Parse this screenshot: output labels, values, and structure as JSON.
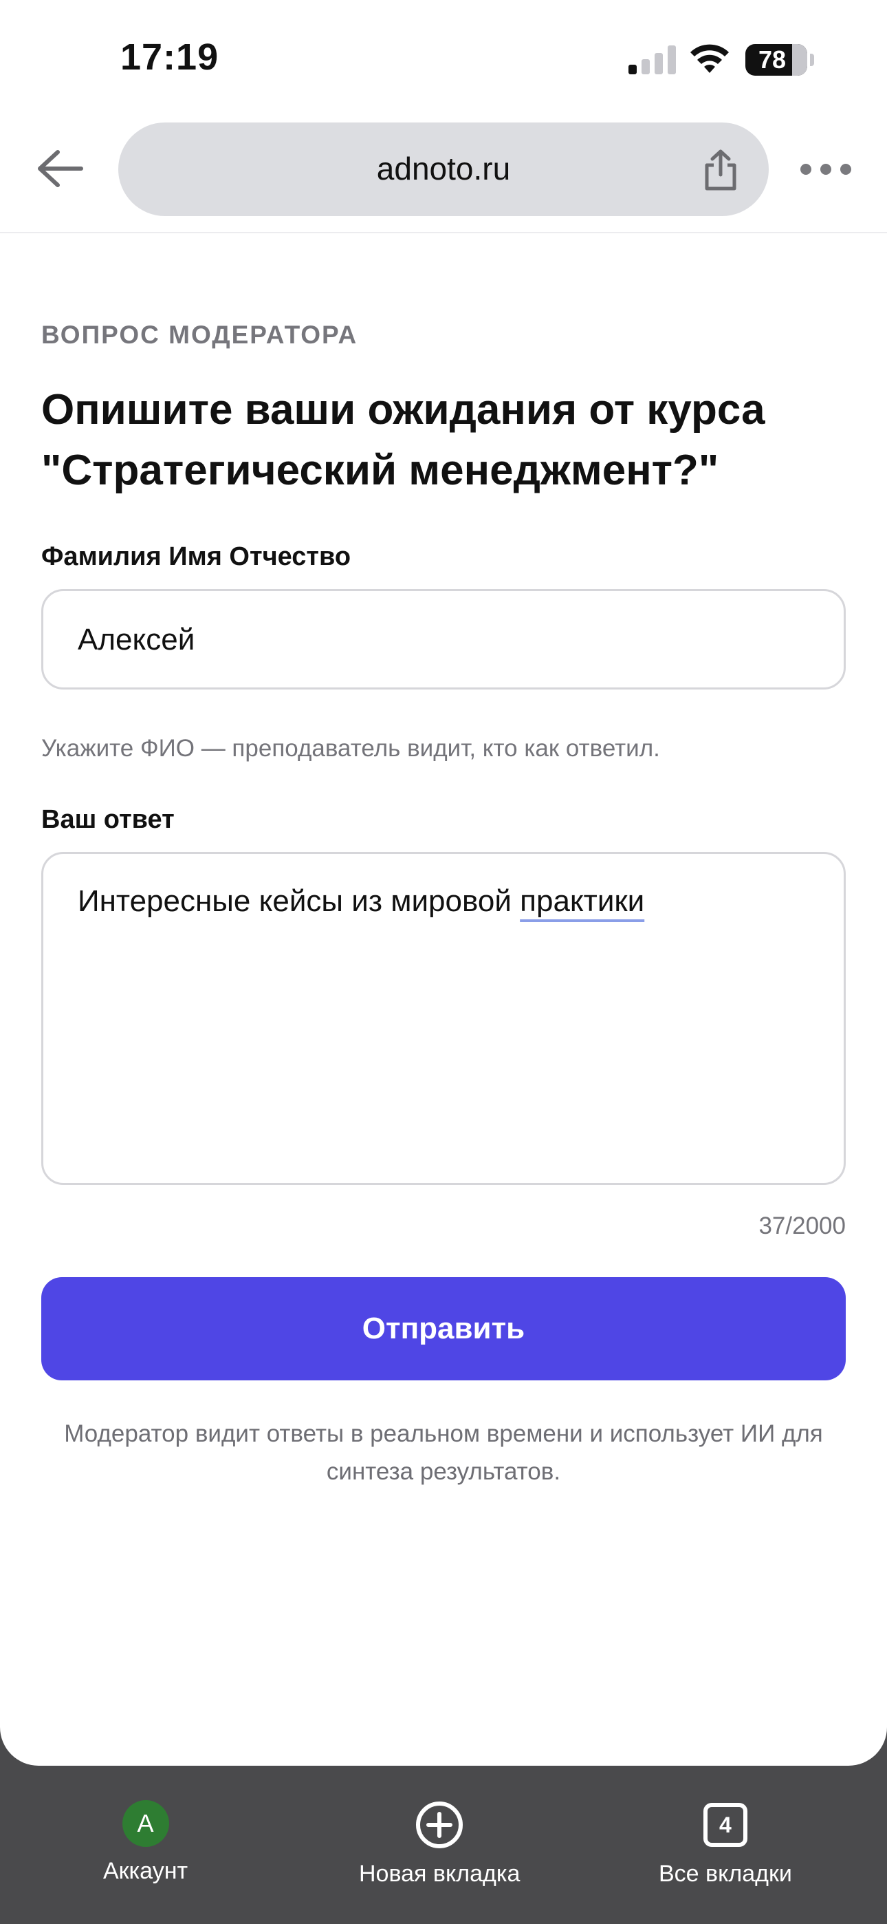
{
  "status_bar": {
    "time": "17:19",
    "battery": "78"
  },
  "browser": {
    "url": "adnoto.ru"
  },
  "form": {
    "overline": "ВОПРОС МОДЕРАТОРА",
    "question": "Опишите ваши ожидания от курса \"Стратегический менеджмент?\"",
    "name_label": "Фамилия Имя Отчество",
    "name_value": "Алексей",
    "name_hint": "Укажите ФИО — преподаватель видит, кто как ответил.",
    "answer_label": "Ваш ответ",
    "answer_value_part1": "Интересные кейсы из мировой ",
    "answer_value_part2": "практики",
    "counter": "37/2000",
    "submit_label": "Отправить",
    "footer_note": "Модератор видит ответы в реальном времени и использует ИИ для синтеза результатов."
  },
  "toolbar": {
    "account_initial": "А",
    "account_label": "Аккаунт",
    "new_tab_label": "Новая вкладка",
    "tabs_count": "4",
    "all_tabs_label": "Все вкладки"
  },
  "colors": {
    "accent": "#4f46e5",
    "avatar": "#2e7d32"
  },
  "icons": [
    "back-arrow-icon",
    "share-icon",
    "more-icon",
    "plus-circle-icon",
    "tabs-icon",
    "signal-icon",
    "wifi-icon",
    "battery-icon"
  ]
}
